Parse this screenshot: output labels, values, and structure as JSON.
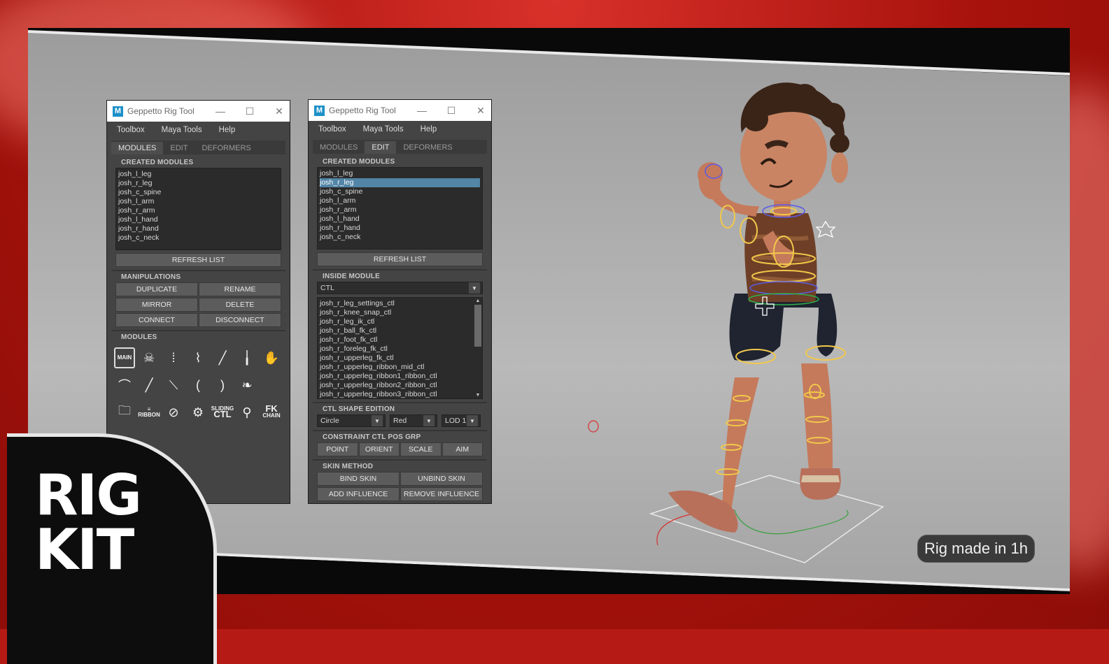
{
  "left_window": {
    "title": "Geppetto Rig Tool",
    "menus": [
      "Toolbox",
      "Maya Tools",
      "Help"
    ],
    "tabs": [
      "MODULES",
      "EDIT",
      "DEFORMERS"
    ],
    "active_tab": "MODULES",
    "created_modules_label": "CREATED MODULES",
    "modules": [
      "josh_l_leg",
      "josh_r_leg",
      "josh_c_spine",
      "josh_l_arm",
      "josh_r_arm",
      "josh_l_hand",
      "josh_r_hand",
      "josh_c_neck"
    ],
    "refresh_label": "REFRESH LIST",
    "manipulations_label": "MANIPULATIONS",
    "manip_buttons": [
      [
        "DUPLICATE",
        "RENAME"
      ],
      [
        "MIRROR",
        "DELETE"
      ],
      [
        "CONNECT",
        "DISCONNECT"
      ]
    ],
    "modules_label": "MODULES",
    "icon_labels": {
      "main": "MAIN",
      "ribbon": "RIBBON",
      "sliding": "SLIDING",
      "ctl": "CTL",
      "fk": "FK",
      "chain": "CHAIN"
    }
  },
  "right_window": {
    "title": "Geppetto Rig Tool",
    "menus": [
      "Toolbox",
      "Maya Tools",
      "Help"
    ],
    "tabs": [
      "MODULES",
      "EDIT",
      "DEFORMERS"
    ],
    "active_tab": "EDIT",
    "created_modules_label": "CREATED MODULES",
    "modules": [
      "josh_l_leg",
      "josh_r_leg",
      "josh_c_spine",
      "josh_l_arm",
      "josh_r_arm",
      "josh_l_hand",
      "josh_r_hand",
      "josh_c_neck"
    ],
    "selected_module": "josh_r_leg",
    "refresh_label": "REFRESH LIST",
    "inside_module_label": "INSIDE MODULE",
    "inside_module_value": "CTL",
    "controls": [
      "josh_r_leg_settings_ctl",
      "josh_r_knee_snap_ctl",
      "josh_r_leg_ik_ctl",
      "josh_r_ball_fk_ctl",
      "josh_r_foot_fk_ctl",
      "josh_r_foreleg_fk_ctl",
      "josh_r_upperleg_fk_ctl",
      "josh_r_upperleg_ribbon_mid_ctl",
      "josh_r_upperleg_ribbon1_ribbon_ctl",
      "josh_r_upperleg_ribbon2_ribbon_ctl",
      "josh_r_upperleg_ribbon3_ribbon_ctl"
    ],
    "ctl_shape_label": "CTL SHAPE EDITION",
    "shape_value": "Circle",
    "color_value": "Red",
    "lod_value": "LOD 1",
    "constraint_label": "CONSTRAINT CTL POS GRP",
    "constraint_buttons": [
      "POINT",
      "ORIENT",
      "SCALE",
      "AIM"
    ],
    "skin_label": "SKIN METHOD",
    "skin_buttons": [
      [
        "BIND SKIN",
        "UNBIND SKIN"
      ],
      [
        "ADD INFLUENCE",
        "REMOVE INFLUENCE"
      ]
    ]
  },
  "logo": {
    "line1": "RIG",
    "line2": "KIT"
  },
  "badge": "Rig made in 1h"
}
